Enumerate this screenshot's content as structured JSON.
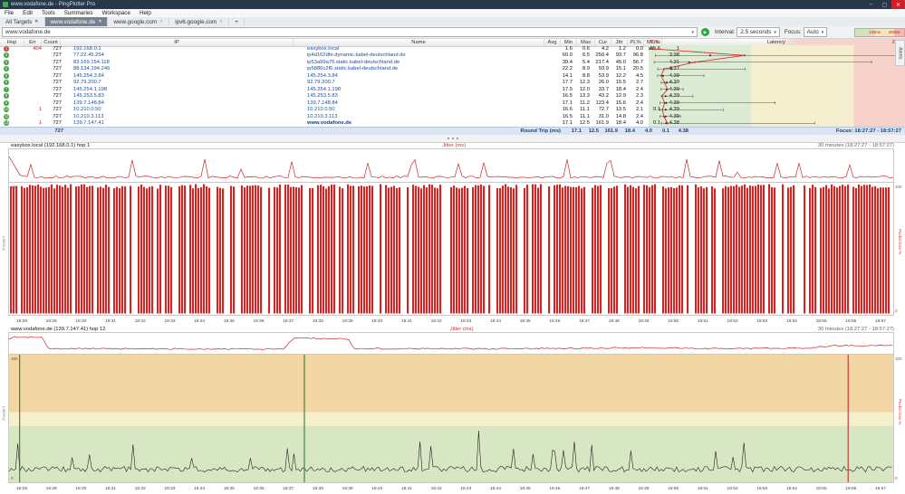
{
  "window": {
    "title": "www.vodafone.de - PingPlotter Pro",
    "minimize_glyph": "–",
    "maximize_glyph": "▢",
    "close_glyph": "✕"
  },
  "menu": {
    "items": [
      "File",
      "Edit",
      "Tools",
      "Summaries",
      "Workspace",
      "Help"
    ]
  },
  "tabs": [
    {
      "label": "All Targets",
      "mark": "✕",
      "active": false
    },
    {
      "label": "www.vodafone.de",
      "mark": "✕",
      "active": true
    },
    {
      "label": "www.google.com",
      "mark": "✓",
      "active": false
    },
    {
      "label": "ipv6.google.com",
      "mark": "✓",
      "active": false
    },
    {
      "label": "+",
      "mark": "",
      "active": false
    }
  ],
  "toolbar": {
    "target_value": "www.vodafone.de",
    "dropdown_glyph": "▾",
    "play_glyph": "▶",
    "interval_label": "Interval:",
    "interval_value": "2.5 seconds",
    "focus_label": "Focus:",
    "focus_value": "Auto",
    "legend_labels": [
      "100ms",
      "200ms"
    ],
    "alerts_tab_label": "Alerts"
  },
  "table": {
    "headers": [
      "Hop",
      "Err",
      "Count",
      "IP",
      "Name",
      "Avg",
      "Min",
      "Max",
      "Cur",
      "Jttr",
      "PL%",
      "MOS"
    ],
    "latency_header": {
      "label": "Latency",
      "scale_min": "0 ms",
      "scale_max": "250 ms"
    },
    "rows": [
      {
        "hop": "1",
        "icon": "#cf4040",
        "err": "404",
        "count": "727",
        "ip": "192.168.0.1",
        "name": "easybox.local",
        "avg": "1.6",
        "min": "0.6",
        "max": "4.2",
        "cur": "1.2",
        "jttr": "0.0",
        "pl": "55.6",
        "mos": "1"
      },
      {
        "hop": "2",
        "icon": "#44a044",
        "err": "",
        "count": "727",
        "ip": "77.22.45.254",
        "name": "ip4d162dfe.dynamic.kabel-deutschland.de",
        "avg": "60.0",
        "min": "6.5",
        "max": "250.4",
        "cur": "93.7",
        "jttr": "96.8",
        "pl": "",
        "mos": "3.98"
      },
      {
        "hop": "3",
        "icon": "#44a044",
        "err": "",
        "count": "727",
        "ip": "83.169.154.118",
        "name": "ip53a99a76.static.kabel-deutschland.de",
        "avg": "39.4",
        "min": "5.4",
        "max": "217.4",
        "cur": "45.0",
        "jttr": "56.7",
        "pl": "",
        "mos": "4.31"
      },
      {
        "hop": "4",
        "icon": "#44a044",
        "err": "",
        "count": "727",
        "ip": "88.134.194.246",
        "name": "ip5886c2f6.static.kabel-deutschland.de",
        "avg": "22.2",
        "min": "8.9",
        "max": "93.9",
        "cur": "15.1",
        "jttr": "20.5",
        "pl": "",
        "mos": "4.37"
      },
      {
        "hop": "5",
        "icon": "#44a044",
        "err": "",
        "count": "727",
        "ip": "145.254.3.84",
        "name": "145.254.3.84",
        "avg": "14.1",
        "min": "8.8",
        "max": "53.9",
        "cur": "12.2",
        "jttr": "4.5",
        "pl": "",
        "mos": "4.39"
      },
      {
        "hop": "6",
        "icon": "#44a044",
        "err": "",
        "count": "727",
        "ip": "92.79.200.7",
        "name": "92.79.200.7",
        "avg": "17.7",
        "min": "12.3",
        "max": "26.0",
        "cur": "15.5",
        "jttr": "2.7",
        "pl": "",
        "mos": "4.39"
      },
      {
        "hop": "7",
        "icon": "#44a044",
        "err": "",
        "count": "727",
        "ip": "145.254.1.198",
        "name": "145.254.1.198",
        "avg": "17.5",
        "min": "12.0",
        "max": "33.7",
        "cur": "18.4",
        "jttr": "2.4",
        "pl": "",
        "mos": "4.39"
      },
      {
        "hop": "8",
        "icon": "#44a044",
        "err": "",
        "count": "727",
        "ip": "145.253.5.83",
        "name": "145.253.5.83",
        "avg": "16.5",
        "min": "13.3",
        "max": "43.2",
        "cur": "12.9",
        "jttr": "2.3",
        "pl": "",
        "mos": "4.39"
      },
      {
        "hop": "9",
        "icon": "#44a044",
        "err": "",
        "count": "727",
        "ip": "139.7.148.84",
        "name": "139.7.148.84",
        "avg": "17.1",
        "min": "11.2",
        "max": "123.4",
        "cur": "15.6",
        "jttr": "2.4",
        "pl": "",
        "mos": "4.39"
      },
      {
        "hop": "10",
        "icon": "#44a044",
        "err": "1",
        "count": "727",
        "ip": "10.210.0.50",
        "name": "10.210.0.50",
        "avg": "16.6",
        "min": "11.1",
        "max": "72.7",
        "cur": "13.5",
        "jttr": "2.1",
        "pl": "0.1",
        "mos": "4.39"
      },
      {
        "hop": "11",
        "icon": "#44a044",
        "err": "",
        "count": "727",
        "ip": "10.210.3.113",
        "name": "10.210.3.113",
        "avg": "16.5",
        "min": "11.1",
        "max": "31.0",
        "cur": "14.8",
        "jttr": "2.4",
        "pl": "",
        "mos": "4.39"
      },
      {
        "hop": "12",
        "icon": "#44a044",
        "err": "1",
        "count": "727",
        "ip": "139.7.147.41",
        "name": "www.vodafone.de",
        "avg": "17.1",
        "min": "12.5",
        "max": "161.9",
        "cur": "18.4",
        "jttr": "4.0",
        "pl": "0.1",
        "mos": "4.38"
      }
    ],
    "summary": {
      "count": "727",
      "label": "Round Trip (ms)",
      "avg": "17.1",
      "min": "12.5",
      "max": "161.9",
      "cur": "18.4",
      "jttr": "4.0",
      "pl": "0.1",
      "mos": "4.38",
      "focus": "Focus: 18:27:27 - 18:57:27"
    }
  },
  "chart_data": {
    "x_ticks": [
      "18:28",
      "18:29",
      "18:30",
      "18:31",
      "18:32",
      "18:33",
      "18:34",
      "18:35",
      "18:36",
      "18:37",
      "18:38",
      "18:39",
      "18:40",
      "18:41",
      "18:42",
      "18:43",
      "18:44",
      "18:45",
      "18:46",
      "18:47",
      "18:48",
      "18:49",
      "18:50",
      "18:51",
      "18:52",
      "18:53",
      "18:54",
      "18:55",
      "18:56",
      "18:57"
    ],
    "latency_scale": {
      "min_ms": 0,
      "max_ms": 250,
      "green_to_ms": 100,
      "yellow_to_ms": 200
    },
    "graphs": [
      {
        "type": "area",
        "hop_label": "easybox.local (192.168.0.1) hop 1",
        "metric_label": "Jitter (ms)",
        "timespan_label": "30 minutes (18:27:27 - 18:57:27)",
        "y_left": {
          "label": "Latency",
          "max": "150",
          "min": "0"
        },
        "y_right": {
          "label": "Packet loss %",
          "max": "100",
          "min": "0"
        },
        "packet_loss_bars": {
          "approx_loss_pct": 55.6,
          "coverage": 0.86,
          "color": "#d42323",
          "seed": 11
        },
        "jitter_line": {
          "color": "#c62828",
          "profile": "low-with-spikes",
          "seed": 5
        }
      },
      {
        "type": "line",
        "hop_label": "www.vodafone.de (139.7.147.41) hop 12",
        "metric_label": "Jitter (ms)",
        "timespan_label": "30 minutes (18:27:27 - 18:57:27)",
        "y_left": {
          "label": "Latency",
          "max": "180",
          "min": "0"
        },
        "y_right": {
          "label": "Packet loss %",
          "max": "100",
          "min": "0"
        },
        "background_zones": [
          {
            "frac": 0.45,
            "color": "#f2d6a4"
          },
          {
            "frac": 0.11,
            "color": "#f6efcb"
          },
          {
            "frac": 0.44,
            "color": "#d7e7c4"
          }
        ],
        "event_lines": [
          {
            "x_frac": 0.012,
            "color": "#2e6b2e"
          },
          {
            "x_frac": 0.334,
            "color": "#2e6b2e"
          },
          {
            "x_frac": 0.949,
            "color": "#c81e1e"
          }
        ],
        "latency_trace": {
          "color": "#222222",
          "base_frac": 0.92,
          "seed": 23
        },
        "jitter_line": {
          "color": "#c62828",
          "seed": 9,
          "keypoints": [
            [
              0,
              0.3
            ],
            [
              0.004,
              0.18
            ],
            [
              0.038,
              0.2
            ],
            [
              0.044,
              0.72
            ],
            [
              0.31,
              0.74
            ],
            [
              0.322,
              0.26
            ],
            [
              0.33,
              0.24
            ],
            [
              0.383,
              0.26
            ],
            [
              0.39,
              0.72
            ],
            [
              0.55,
              0.73
            ],
            [
              0.72,
              0.68
            ],
            [
              0.8,
              0.72
            ],
            [
              0.9,
              0.7
            ],
            [
              0.935,
              0.58
            ],
            [
              0.97,
              0.6
            ],
            [
              1,
              0.55
            ]
          ]
        }
      }
    ]
  }
}
